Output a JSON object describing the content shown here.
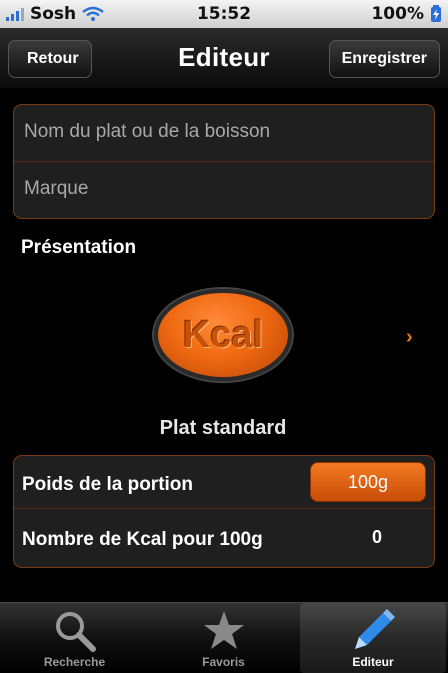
{
  "status_bar": {
    "carrier": "Sosh",
    "time": "15:52",
    "battery": "100%",
    "signal_color": "#2a6fd8"
  },
  "nav": {
    "back_label": "Retour",
    "title": "Editeur",
    "save_label": "Enregistrer"
  },
  "fields": {
    "name_placeholder": "Nom du plat ou de la boisson",
    "brand_placeholder": "Marque"
  },
  "presentation": {
    "label": "Présentation",
    "badge_text": "Kcal",
    "caption": "Plat standard",
    "accent": "#f06a12"
  },
  "portion": {
    "label": "Poids de la portion",
    "value": "100g"
  },
  "kcal": {
    "label": "Nombre de Kcal pour 100g",
    "value": "0"
  },
  "tabs": [
    {
      "label": "Recherche",
      "icon": "search-icon",
      "active": false
    },
    {
      "label": "Favoris",
      "icon": "star-icon",
      "active": false
    },
    {
      "label": "Editeur",
      "icon": "pencil-icon",
      "active": true
    }
  ]
}
